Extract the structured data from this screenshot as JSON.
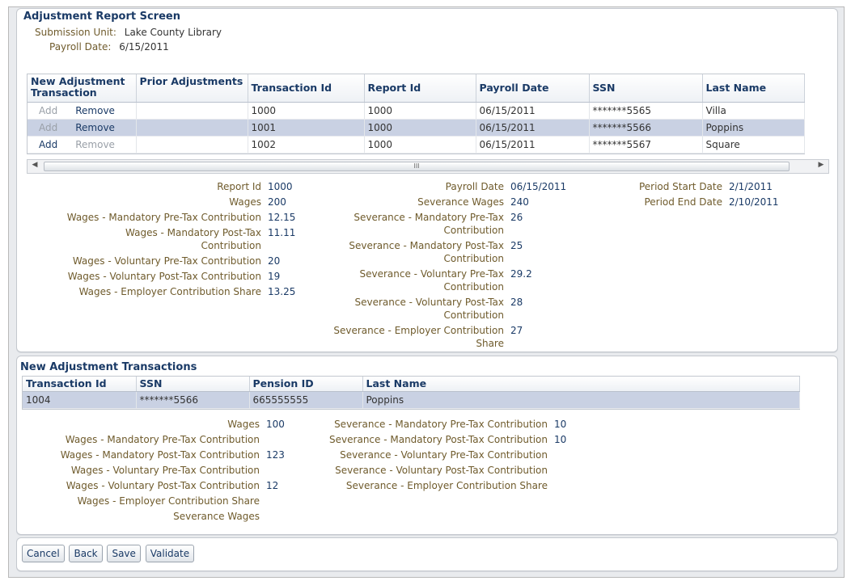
{
  "screen": {
    "title": "Adjustment Report Screen",
    "submission_unit_label": "Submission Unit:",
    "submission_unit_value": "Lake County Library",
    "payroll_date_label": "Payroll Date:",
    "payroll_date_value": "6/15/2011"
  },
  "adjustments_table": {
    "columns": [
      "New Adjustment Transaction",
      "Prior Adjustments",
      "Transaction Id",
      "Report Id",
      "Payroll Date",
      "SSN",
      "Last Name"
    ],
    "rows": [
      {
        "add": "Add",
        "remove": "Remove",
        "prior": "",
        "transaction_id": "1000",
        "report_id": "1000",
        "payroll_date": "06/15/2011",
        "ssn": "*******5565",
        "last_name": "Villa",
        "add_enabled": false,
        "remove_enabled": true,
        "selected": false
      },
      {
        "add": "Add",
        "remove": "Remove",
        "prior": "",
        "transaction_id": "1001",
        "report_id": "1000",
        "payroll_date": "06/15/2011",
        "ssn": "*******5566",
        "last_name": "Poppins",
        "add_enabled": false,
        "remove_enabled": true,
        "selected": true
      },
      {
        "add": "Add",
        "remove": "Remove",
        "prior": "",
        "transaction_id": "1002",
        "report_id": "1000",
        "payroll_date": "06/15/2011",
        "ssn": "*******5567",
        "last_name": "Square",
        "add_enabled": true,
        "remove_enabled": false,
        "selected": false
      }
    ],
    "scroll_glyph": "III"
  },
  "detail_col1": [
    {
      "label": "Report Id",
      "value": "1000"
    },
    {
      "label": "Wages",
      "value": "200"
    },
    {
      "label": "Wages - Mandatory Pre-Tax Contribution",
      "value": "12.15"
    },
    {
      "label": "Wages - Mandatory Post-Tax\nContribution",
      "value": "11.11"
    },
    {
      "label": "Wages - Voluntary Pre-Tax Contribution",
      "value": "20"
    },
    {
      "label": "Wages - Voluntary Post-Tax Contribution",
      "value": "19"
    },
    {
      "label": "Wages - Employer Contribution Share",
      "value": "13.25"
    }
  ],
  "detail_col2": [
    {
      "label": "Payroll Date",
      "value": "06/15/2011"
    },
    {
      "label": "Severance Wages",
      "value": "240"
    },
    {
      "label": "Severance - Mandatory Pre-Tax\nContribution",
      "value": "26"
    },
    {
      "label": "Severance - Mandatory Post-Tax\nContribution",
      "value": "25"
    },
    {
      "label": "Severance - Voluntary Pre-Tax\nContribution",
      "value": "29.2"
    },
    {
      "label": "Severance - Voluntary Post-Tax\nContribution",
      "value": "28"
    },
    {
      "label": "Severance - Employer Contribution\nShare",
      "value": "27"
    }
  ],
  "detail_col3": [
    {
      "label": "Period Start Date",
      "value": "2/1/2011"
    },
    {
      "label": "Period End Date",
      "value": "2/10/2011"
    }
  ],
  "new_adj": {
    "title": "New Adjustment Transactions",
    "columns": [
      "Transaction Id",
      "SSN",
      "Pension ID",
      "Last Name"
    ],
    "rows": [
      {
        "transaction_id": "1004",
        "ssn": "*******5566",
        "pension_id": "665555555",
        "last_name": "Poppins"
      }
    ]
  },
  "new_col1": [
    {
      "label": "Wages",
      "value": "100"
    },
    {
      "label": "Wages - Mandatory Pre-Tax Contribution",
      "value": ""
    },
    {
      "label": "Wages - Mandatory Post-Tax Contribution",
      "value": "123"
    },
    {
      "label": "Wages - Voluntary Pre-Tax Contribution",
      "value": ""
    },
    {
      "label": "Wages - Voluntary Post-Tax Contribution",
      "value": "12"
    },
    {
      "label": "Wages - Employer Contribution Share",
      "value": ""
    },
    {
      "label": "Severance Wages",
      "value": ""
    }
  ],
  "new_col2": [
    {
      "label": "Severance - Mandatory Pre-Tax Contribution",
      "value": "10"
    },
    {
      "label": "Severance - Mandatory Post-Tax Contribution",
      "value": "10"
    },
    {
      "label": "Severance - Voluntary Pre-Tax Contribution",
      "value": ""
    },
    {
      "label": "Severance - Voluntary Post-Tax Contribution",
      "value": ""
    },
    {
      "label": "Severance - Employer Contribution Share",
      "value": ""
    }
  ],
  "buttons": {
    "cancel": "Cancel",
    "back": "Back",
    "save": "Save",
    "validate": "Validate"
  }
}
